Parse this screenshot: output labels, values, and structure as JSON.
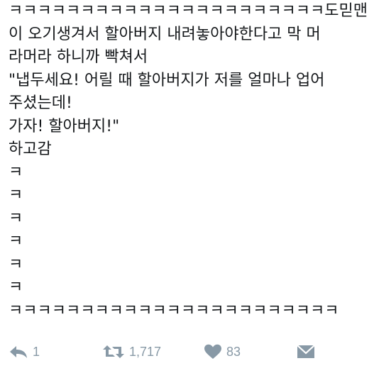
{
  "tweet": {
    "lines": [
      "ㅋㅋㅋㅋㅋㅋㅋㅋㅋㅋㅋㅋㅋㅋㅋㅋㅋㅋㅋㅋㅋㅋ도믿맨",
      "이 오기생겨서 할아버지 내려놓아야한다고 막 머",
      "라머라 하니까 빡쳐서",
      "\"냅두세요! 어릴 때 할아버지가 저를 얼마나 업어",
      "주셨는데!",
      "가자! 할아버지!\"",
      "하고감",
      "ㅋ",
      "ㅋ",
      "ㅋ",
      "ㅋ",
      "ㅋ",
      "ㅋ",
      "ㅋㅋㅋㅋㅋㅋㅋㅋㅋㅋㅋㅋㅋㅋㅋㅋㅋㅋㅋㅋㅋㅋㅋ"
    ]
  },
  "actions": {
    "reply": {
      "icon": "reply-icon",
      "count": "1"
    },
    "retweet": {
      "icon": "retweet-icon",
      "count": "1,717"
    },
    "like": {
      "icon": "heart-icon",
      "count": "83"
    },
    "dm": {
      "icon": "envelope-icon"
    }
  },
  "colors": {
    "text": "#14171a",
    "icon": "#8899a6",
    "background": "#ffffff"
  }
}
